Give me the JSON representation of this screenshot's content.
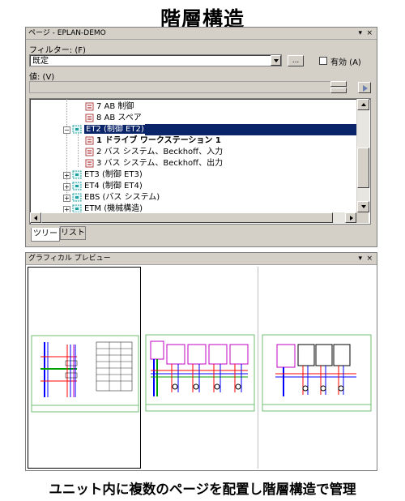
{
  "page_title": "階層構造",
  "caption": "ユニット内に複数のページを配置し階層構造で管理",
  "pages_panel": {
    "title": "ページ - EPLAN-DEMO",
    "controls": [
      "▾",
      "×"
    ],
    "filter_label": "フィルター: (F)",
    "filter_value": "既定",
    "more_button": "...",
    "active_label": "有効 (A)",
    "value_label": "値: (V)"
  },
  "tree": {
    "nodes": [
      {
        "label": "7 AB 制御",
        "bold": false,
        "selected": false,
        "kind": "page"
      },
      {
        "label": "8 AB スペア",
        "bold": false,
        "selected": false,
        "kind": "page"
      },
      {
        "label": "ET2 (制御 ET2)",
        "bold": false,
        "selected": true,
        "kind": "unit",
        "expander": "−"
      },
      {
        "label": "1 ドライブ ワークステーション 1",
        "bold": true,
        "selected": false,
        "kind": "page"
      },
      {
        "label": "2 バス システム、Beckhoff、入力",
        "bold": false,
        "selected": false,
        "kind": "page"
      },
      {
        "label": "3 バス システム、Beckhoff、出力",
        "bold": false,
        "selected": false,
        "kind": "page"
      },
      {
        "label": "ET3 (制御 ET3)",
        "bold": false,
        "selected": false,
        "kind": "unit",
        "expander": "+"
      },
      {
        "label": "ET4 (制御 ET4)",
        "bold": false,
        "selected": false,
        "kind": "unit",
        "expander": "+"
      },
      {
        "label": "EBS (バス システム)",
        "bold": false,
        "selected": false,
        "kind": "unit",
        "expander": "+"
      },
      {
        "label": "ETM (機械構造)",
        "bold": false,
        "selected": false,
        "kind": "unit",
        "expander": "+"
      }
    ]
  },
  "tabs": [
    {
      "label": "ツリー",
      "active": true
    },
    {
      "label": "リスト",
      "active": false
    }
  ],
  "preview_panel": {
    "title": "グラフィカル プレビュー",
    "controls": [
      "▾",
      "×"
    ],
    "thumbnails": 3
  },
  "colors": {
    "panel_bg": "#d4d0c8",
    "selection": "#0a246a",
    "wire_blue": "#0000ff",
    "wire_red": "#ff0000",
    "wire_green": "#00a000",
    "border_magenta": "#c000c0"
  }
}
